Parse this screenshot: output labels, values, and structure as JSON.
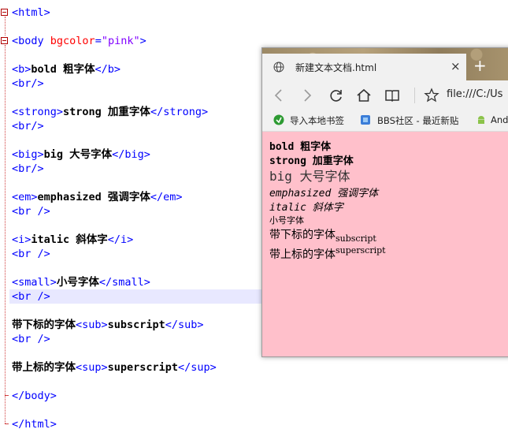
{
  "editor": {
    "lines": [
      [
        {
          "t": "tag",
          "v": "<html>"
        }
      ],
      [],
      [
        {
          "t": "tag",
          "v": "<body "
        },
        {
          "t": "attr",
          "v": "bgcolor"
        },
        {
          "t": "tag",
          "v": "="
        },
        {
          "t": "str",
          "v": "\"pink\""
        },
        {
          "t": "tag",
          "v": ">"
        }
      ],
      [],
      [
        {
          "t": "tag",
          "v": "<b>"
        },
        {
          "t": "txt",
          "v": "bold 粗字体"
        },
        {
          "t": "tag",
          "v": "</b>"
        }
      ],
      [
        {
          "t": "tag",
          "v": "<br/>"
        }
      ],
      [],
      [
        {
          "t": "tag",
          "v": "<strong>"
        },
        {
          "t": "txt",
          "v": "strong 加重字体"
        },
        {
          "t": "tag",
          "v": "</strong>"
        }
      ],
      [
        {
          "t": "tag",
          "v": "<br/>"
        }
      ],
      [],
      [
        {
          "t": "tag",
          "v": "<big>"
        },
        {
          "t": "txt",
          "v": "big 大号字体"
        },
        {
          "t": "tag",
          "v": "</big>"
        }
      ],
      [
        {
          "t": "tag",
          "v": "<br/>"
        }
      ],
      [],
      [
        {
          "t": "tag",
          "v": "<em>"
        },
        {
          "t": "txt",
          "v": "emphasized 强调字体"
        },
        {
          "t": "tag",
          "v": "</em>"
        }
      ],
      [
        {
          "t": "tag",
          "v": "<br />"
        }
      ],
      [],
      [
        {
          "t": "tag",
          "v": "<i>"
        },
        {
          "t": "txt",
          "v": "italic 斜体字"
        },
        {
          "t": "tag",
          "v": "</i>"
        }
      ],
      [
        {
          "t": "tag",
          "v": "<br />"
        }
      ],
      [],
      [
        {
          "t": "tag",
          "v": "<small>"
        },
        {
          "t": "txt",
          "v": "小号字体"
        },
        {
          "t": "tag",
          "v": "</small>"
        }
      ],
      [
        {
          "t": "tag",
          "v": "<br />"
        }
      ],
      [],
      [
        {
          "t": "txt",
          "v": "带下标的字体"
        },
        {
          "t": "tag",
          "v": "<sub>"
        },
        {
          "t": "txt",
          "v": "subscript"
        },
        {
          "t": "tag",
          "v": "</sub>"
        }
      ],
      [
        {
          "t": "tag",
          "v": "<br />"
        }
      ],
      [],
      [
        {
          "t": "txt",
          "v": "带上标的字体"
        },
        {
          "t": "tag",
          "v": "<sup>"
        },
        {
          "t": "txt",
          "v": "superscript"
        },
        {
          "t": "tag",
          "v": "</sup>"
        }
      ],
      [],
      [
        {
          "t": "tag",
          "v": "</body>"
        }
      ],
      [],
      [
        {
          "t": "tag",
          "v": "</html>"
        }
      ]
    ],
    "highlighted_line": 20,
    "colors": {
      "tag": "#0000ff",
      "attr": "#ff0000",
      "str": "#8000ff",
      "text": "#000000",
      "current_line": "#e8e8ff"
    }
  },
  "browser": {
    "tab_title": "新建文本文档.html",
    "tab_close": "×",
    "new_tab": "+",
    "address": "file:///C:/Us",
    "favorites": [
      {
        "label": "导入本地书签",
        "icon": "import-icon"
      },
      {
        "label": "BBS社区 - 最近新贴",
        "icon": "bbs-icon"
      },
      {
        "label": "And",
        "icon": "android-icon"
      }
    ],
    "page_bg": "#ffc0cb",
    "content": {
      "bold": "bold 粗字体",
      "strong": "strong 加重字体",
      "big": "big 大号字体",
      "em": "emphasized 强调字体",
      "italic": "italic 斜体字",
      "small": "小号字体",
      "sub_text": "带下标的字体",
      "sub": "subscript",
      "sup_text": "带上标的字体",
      "sup": "superscript"
    }
  }
}
